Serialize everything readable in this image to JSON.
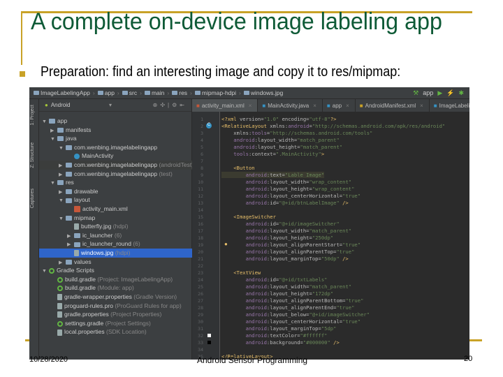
{
  "slide": {
    "title": "A complete on-device image labeling app",
    "bullet": "Preparation: find an interesting image and copy it to res/mipmap:",
    "footer_date": "10/28/2020",
    "footer_title": "Android Sensor Programming",
    "page_number": "20",
    "accent_color": "#c9a227",
    "title_color": "#0e5a36"
  },
  "ide": {
    "breadcrumbs": [
      "ImageLabelingApp",
      "app",
      "src",
      "main",
      "res",
      "mipmap-hdpi",
      "windows.jpg"
    ],
    "toolbar_right": {
      "run_config": "app"
    },
    "side_tabs": [
      "1: Project",
      "Z: Structure",
      "Captures"
    ],
    "project_view": "Android",
    "tree": [
      {
        "label": "app",
        "depth": 0,
        "arrow": "open",
        "icon": "folder"
      },
      {
        "label": "manifests",
        "depth": 1,
        "arrow": "closed",
        "icon": "folder"
      },
      {
        "label": "java",
        "depth": 1,
        "arrow": "open",
        "icon": "folder"
      },
      {
        "label": "com.wenbing.imagelabelingapp",
        "depth": 2,
        "arrow": "open",
        "icon": "folder"
      },
      {
        "label": "MainActivity",
        "depth": 3,
        "arrow": "",
        "icon": "cls"
      },
      {
        "label": "com.wenbing.imagelabelingapp",
        "hint": "(androidTest)",
        "depth": 2,
        "arrow": "closed",
        "icon": "folder",
        "alt": true
      },
      {
        "label": "com.wenbing.imagelabelingapp",
        "hint": "(test)",
        "depth": 2,
        "arrow": "closed",
        "icon": "folder"
      },
      {
        "label": "res",
        "depth": 1,
        "arrow": "open",
        "icon": "folder"
      },
      {
        "label": "drawable",
        "depth": 2,
        "arrow": "closed",
        "icon": "folder"
      },
      {
        "label": "layout",
        "depth": 2,
        "arrow": "open",
        "icon": "folder"
      },
      {
        "label": "activity_main.xml",
        "depth": 3,
        "arrow": "",
        "icon": "xml"
      },
      {
        "label": "mipmap",
        "depth": 2,
        "arrow": "open",
        "icon": "folder"
      },
      {
        "label": "butterfly.jpg",
        "hint": "(hdpi)",
        "depth": 3,
        "arrow": "",
        "icon": "file"
      },
      {
        "label": "ic_launcher",
        "hint": "(6)",
        "depth": 3,
        "arrow": "closed",
        "icon": "folder"
      },
      {
        "label": "ic_launcher_round",
        "hint": "(6)",
        "depth": 3,
        "arrow": "closed",
        "icon": "folder"
      },
      {
        "label": "windows.jpg",
        "hint": "(hdpi)",
        "depth": 3,
        "arrow": "",
        "icon": "file",
        "selected": true
      },
      {
        "label": "values",
        "depth": 2,
        "arrow": "closed",
        "icon": "folder"
      },
      {
        "label": "Gradle Scripts",
        "depth": 0,
        "arrow": "open",
        "icon": "grad"
      },
      {
        "label": "build.gradle",
        "hint": "(Project: ImageLabelingApp)",
        "depth": 1,
        "arrow": "",
        "icon": "grad"
      },
      {
        "label": "build.gradle",
        "hint": "(Module: app)",
        "depth": 1,
        "arrow": "",
        "icon": "grad"
      },
      {
        "label": "gradle-wrapper.properties",
        "hint": "(Gradle Version)",
        "depth": 1,
        "arrow": "",
        "icon": "file"
      },
      {
        "label": "proguard-rules.pro",
        "hint": "(ProGuard Rules for app)",
        "depth": 1,
        "arrow": "",
        "icon": "file"
      },
      {
        "label": "gradle.properties",
        "hint": "(Project Properties)",
        "depth": 1,
        "arrow": "",
        "icon": "file"
      },
      {
        "label": "settings.gradle",
        "hint": "(Project Settings)",
        "depth": 1,
        "arrow": "",
        "icon": "grad"
      },
      {
        "label": "local.properties",
        "hint": "(SDK Location)",
        "depth": 1,
        "arrow": "",
        "icon": "file"
      }
    ],
    "tabs": [
      {
        "label": "activity_main.xml",
        "active": true
      },
      {
        "label": "MainActivity.java"
      },
      {
        "label": "app"
      },
      {
        "label": "AndroidManifest.xml"
      },
      {
        "label": "ImageLabelingApp"
      }
    ],
    "code": [
      [
        [
          "t",
          "<?xml "
        ],
        [
          "an",
          "version="
        ],
        [
          "v",
          "\"1.0\" "
        ],
        [
          "an",
          "encoding="
        ],
        [
          "v",
          "\"utf-8\""
        ],
        [
          "t",
          "?>"
        ]
      ],
      [
        [
          "t",
          "<RelativeLayout "
        ],
        [
          "an",
          "xmlns:"
        ],
        [
          "a",
          "android"
        ],
        [
          "an",
          "="
        ],
        [
          "v",
          "\"http://schemas.android.com/apk/res/android\""
        ]
      ],
      [
        [
          "an",
          "    xmlns:"
        ],
        [
          "a",
          "tools"
        ],
        [
          "an",
          "="
        ],
        [
          "v",
          "\"http://schemas.android.com/tools\""
        ]
      ],
      [
        [
          "a",
          "    android"
        ],
        [
          "an",
          ":layout_width="
        ],
        [
          "v",
          "\"match_parent\""
        ]
      ],
      [
        [
          "a",
          "    android"
        ],
        [
          "an",
          ":layout_height="
        ],
        [
          "v",
          "\"match_parent\""
        ]
      ],
      [
        [
          "a",
          "    tools"
        ],
        [
          "an",
          ":context="
        ],
        [
          "v",
          "\".MainActivity\""
        ],
        [
          "t",
          ">"
        ]
      ],
      [],
      [
        [
          "t",
          "    <Button"
        ]
      ],
      [
        [
          "a",
          "        android"
        ],
        [
          "an",
          ":text="
        ],
        [
          "v",
          "\"Lable Image\""
        ]
      ],
      [
        [
          "a",
          "        android"
        ],
        [
          "an",
          ":layout_width="
        ],
        [
          "v",
          "\"wrap_content\""
        ]
      ],
      [
        [
          "a",
          "        android"
        ],
        [
          "an",
          ":layout_height="
        ],
        [
          "v",
          "\"wrap_content\""
        ]
      ],
      [
        [
          "a",
          "        android"
        ],
        [
          "an",
          ":layout_centerHorizontal="
        ],
        [
          "v",
          "\"true\""
        ]
      ],
      [
        [
          "a",
          "        android"
        ],
        [
          "an",
          ":id="
        ],
        [
          "v",
          "\"@+id/btnLabelImage\""
        ],
        [
          "t",
          " />"
        ]
      ],
      [],
      [
        [
          "t",
          "    <ImageSwitcher"
        ]
      ],
      [
        [
          "a",
          "        android"
        ],
        [
          "an",
          ":id="
        ],
        [
          "v",
          "\"@+id/imageSwitcher\""
        ]
      ],
      [
        [
          "a",
          "        android"
        ],
        [
          "an",
          ":layout_width="
        ],
        [
          "v",
          "\"match_parent\""
        ]
      ],
      [
        [
          "a",
          "        android"
        ],
        [
          "an",
          ":layout_height="
        ],
        [
          "v",
          "\"250dp\""
        ]
      ],
      [
        [
          "a",
          "        android"
        ],
        [
          "an",
          ":layout_alignParentStart="
        ],
        [
          "v",
          "\"true\""
        ]
      ],
      [
        [
          "a",
          "        android"
        ],
        [
          "an",
          ":layout_alignParentTop="
        ],
        [
          "v",
          "\"true\""
        ]
      ],
      [
        [
          "a",
          "        android"
        ],
        [
          "an",
          ":layout_marginTop="
        ],
        [
          "v",
          "\"50dp\""
        ],
        [
          "t",
          " />"
        ]
      ],
      [],
      [
        [
          "t",
          "    <TextView"
        ]
      ],
      [
        [
          "a",
          "        android"
        ],
        [
          "an",
          ":id="
        ],
        [
          "v",
          "\"@+id/txtLabels\""
        ]
      ],
      [
        [
          "a",
          "        android"
        ],
        [
          "an",
          ":layout_width="
        ],
        [
          "v",
          "\"match_parent\""
        ]
      ],
      [
        [
          "a",
          "        android"
        ],
        [
          "an",
          ":layout_height="
        ],
        [
          "v",
          "\"172dp\""
        ]
      ],
      [
        [
          "a",
          "        android"
        ],
        [
          "an",
          ":layout_alignParentBottom="
        ],
        [
          "v",
          "\"true\""
        ]
      ],
      [
        [
          "a",
          "        android"
        ],
        [
          "an",
          ":layout_alignParentEnd="
        ],
        [
          "v",
          "\"true\""
        ]
      ],
      [
        [
          "a",
          "        android"
        ],
        [
          "an",
          ":layout_below="
        ],
        [
          "v",
          "\"@+id/imageSwitcher\""
        ]
      ],
      [
        [
          "a",
          "        android"
        ],
        [
          "an",
          ":layout_centerHorizontal="
        ],
        [
          "v",
          "\"true\""
        ]
      ],
      [
        [
          "a",
          "        android"
        ],
        [
          "an",
          ":layout_marginTop="
        ],
        [
          "v",
          "\"5dp\""
        ]
      ],
      [
        [
          "a",
          "        android"
        ],
        [
          "an",
          ":textColor="
        ],
        [
          "v",
          "\"#ffffff\""
        ]
      ],
      [
        [
          "a",
          "        android"
        ],
        [
          "an",
          ":background="
        ],
        [
          "v",
          "\"#000000\""
        ],
        [
          "t",
          " />"
        ]
      ],
      [],
      [
        [
          "t",
          "</RelativeLayout>"
        ]
      ]
    ]
  }
}
